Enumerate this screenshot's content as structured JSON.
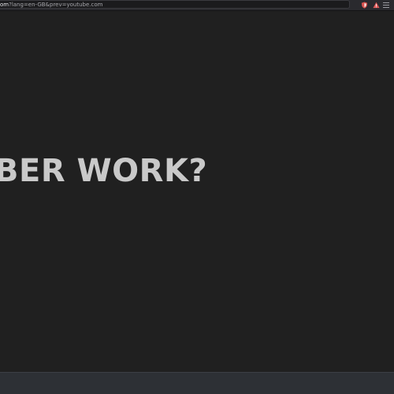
{
  "browser": {
    "url_host": "om",
    "url_rest": "?lang=en-GB&prev=youtube.com"
  },
  "extensions": [
    {
      "icon": "shield-icon",
      "color": "#d9534f"
    },
    {
      "icon": "warning-triangle-icon",
      "color": "#e05a5a"
    }
  ],
  "page": {
    "headline": "BER WORK?"
  },
  "colors": {
    "background": "#202020",
    "text": "#c9c9c9",
    "bottom_bar": "#2d3035"
  }
}
